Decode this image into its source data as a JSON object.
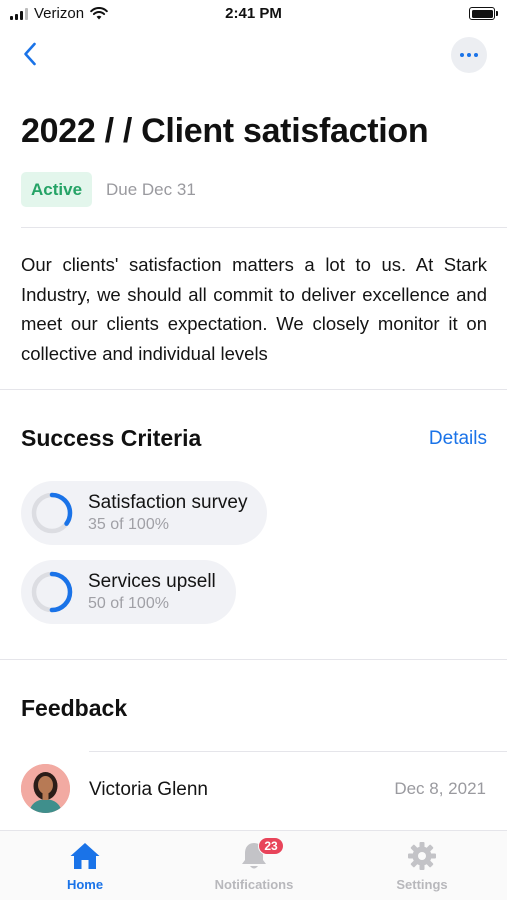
{
  "status_bar": {
    "carrier": "Verizon",
    "time": "2:41 PM"
  },
  "header": {
    "back_icon": "chevron-left-icon",
    "more_icon": "ellipsis-icon"
  },
  "goal": {
    "title": "2022 / / Client satisfaction",
    "status": "Active",
    "due": "Due Dec 31",
    "description": "Our clients' satisfaction matters a lot to us. At Stark Industry, we should all commit to deliver excellence and meet our clients expectation. We closely monitor it on collective and individual levels"
  },
  "success_criteria": {
    "title": "Success Criteria",
    "details_label": "Details",
    "items": [
      {
        "name": "Satisfaction survey",
        "progress_text": "35 of 100%",
        "progress": 0.35
      },
      {
        "name": "Services upsell",
        "progress_text": "50 of 100%",
        "progress": 0.5
      }
    ]
  },
  "feedback": {
    "title": "Feedback",
    "items": [
      {
        "name": "Victoria Glenn",
        "date": "Dec 8, 2021"
      }
    ]
  },
  "tab_bar": {
    "tabs": [
      {
        "label": "Home",
        "icon": "home-icon",
        "active": true
      },
      {
        "label": "Notifications",
        "icon": "bell-icon",
        "badge": "23"
      },
      {
        "label": "Settings",
        "icon": "gear-icon"
      }
    ]
  },
  "colors": {
    "accent": "#1a73e8",
    "active_badge_bg": "#e3f6ec",
    "active_badge_text": "#25a366",
    "notification_badge": "#e8445a"
  }
}
